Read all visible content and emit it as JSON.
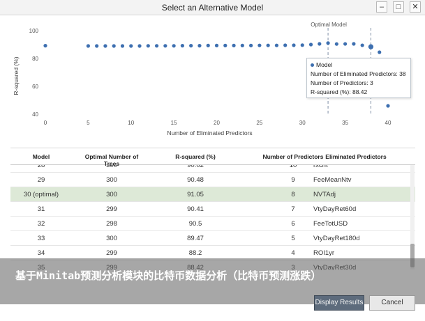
{
  "window": {
    "title": "Select an Alternative Model",
    "min_glyph": "–",
    "max_glyph": "□",
    "close_glyph": "✕"
  },
  "chart_data": {
    "type": "scatter",
    "xlabel": "Number of Eliminated Predictors",
    "ylabel": "R-squared (%)",
    "xlim": [
      0,
      40
    ],
    "ylim": [
      40,
      100
    ],
    "xticks": [
      0,
      5,
      10,
      15,
      20,
      25,
      30,
      35,
      40
    ],
    "yticks": [
      40,
      60,
      80,
      100
    ],
    "reference_lines": [
      {
        "label": "Optimal Model",
        "x": 33
      },
      {
        "x": 38
      }
    ],
    "series": [
      {
        "name": "Model",
        "x": [
          0,
          5,
          6,
          7,
          8,
          9,
          10,
          11,
          12,
          13,
          14,
          15,
          16,
          17,
          18,
          19,
          20,
          21,
          22,
          23,
          24,
          25,
          26,
          27,
          28,
          29,
          30,
          31,
          32,
          33,
          34,
          35,
          36,
          37,
          38,
          39,
          40
        ],
        "y": [
          89.2,
          89.0,
          89.0,
          89.0,
          89.0,
          89.0,
          89.0,
          89.0,
          89.1,
          89.1,
          89.1,
          89.1,
          89.2,
          89.2,
          89.2,
          89.3,
          89.3,
          89.3,
          89.3,
          89.3,
          89.3,
          89.4,
          89.4,
          89.4,
          89.5,
          89.5,
          89.6,
          90.0,
          90.5,
          91.05,
          90.41,
          90.48,
          90.5,
          89.47,
          88.42,
          84.5,
          46.0
        ],
        "highlight_x": 38,
        "color": "#3d6fb0"
      }
    ]
  },
  "tooltip": {
    "legend": "Model",
    "line1": "Number of Eliminated Predictors: 38",
    "line2": "Number of Predictors: 3",
    "line3": "R-squared (%): 88.42"
  },
  "table": {
    "headers": [
      "Model",
      "Optimal Number of Trees",
      "R-squared (%)",
      "Number of Predictors",
      "Eliminated Predictors"
    ],
    "partial_row": [
      "28",
      "300",
      "90.02",
      "10",
      "rxcnt"
    ],
    "rows": [
      [
        "29",
        "300",
        "90.48",
        "9",
        "FeeMeanNtv"
      ],
      [
        "30 (optimal)",
        "300",
        "91.05",
        "8",
        "NVTAdj"
      ],
      [
        "31",
        "299",
        "90.41",
        "7",
        "VtyDayRet60d"
      ],
      [
        "32",
        "298",
        "90.5",
        "6",
        "FeeTotUSD"
      ],
      [
        "33",
        "300",
        "89.47",
        "5",
        "VtyDayRet180d"
      ],
      [
        "34",
        "299",
        "88.2",
        "4",
        "ROI1yr"
      ],
      [
        "35",
        "299",
        "88.42",
        "3",
        "VtyDayRet30d"
      ]
    ],
    "selected_row": 1
  },
  "overlay": {
    "text": "基于Minitab预测分析模块的比特币数据分析（比特币预测涨跌）"
  },
  "buttons": {
    "display": "Display Results",
    "cancel": "Cancel"
  },
  "colors": {
    "accent": "#3d6fb0",
    "selected_row": "#dde9d7",
    "reference_line": "#7f8fa6"
  }
}
